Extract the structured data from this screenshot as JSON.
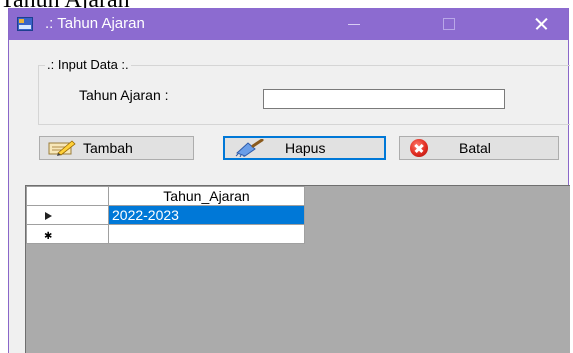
{
  "document": {
    "heading_fragment": "Tahun Ajaran"
  },
  "window": {
    "title": ".: Tahun Ajaran",
    "controls": {
      "minimize": "minimize-icon",
      "maximize": "maximize-icon",
      "close": "close-icon"
    }
  },
  "input_group": {
    "legend": ".: Input Data :.",
    "field_label": "Tahun Ajaran :",
    "field_value": ""
  },
  "buttons": {
    "tambah": "Tambah",
    "hapus": "Hapus",
    "batal": "Batal"
  },
  "grid": {
    "columns": [
      "Tahun_Ajaran"
    ],
    "rows": [
      {
        "indicator": "current-row-arrow",
        "values": [
          "2022-2023"
        ],
        "selected": true
      },
      {
        "indicator": "new-row-asterisk",
        "values": [
          ""
        ],
        "selected": false
      }
    ]
  },
  "colors": {
    "titlebar": "#8c6bd0",
    "selection": "#0078d7",
    "grid_background": "#ababab"
  }
}
